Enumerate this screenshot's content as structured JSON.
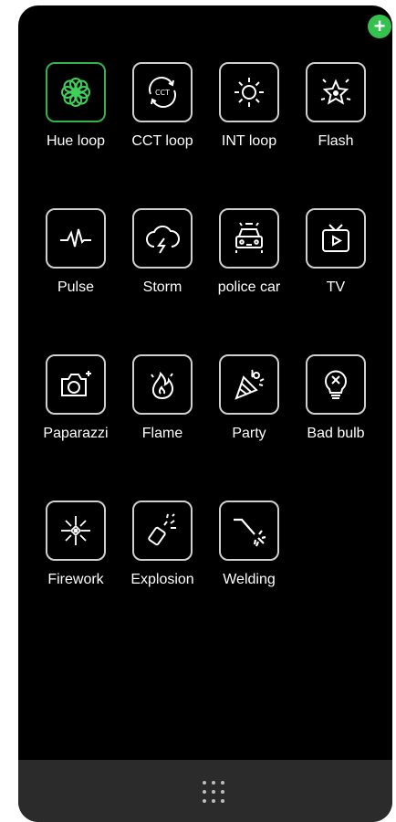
{
  "panel": {
    "add_button_label": "+",
    "effects": [
      {
        "label": "Hue loop",
        "icon": "flower-icon",
        "active": true
      },
      {
        "label": "CCT loop",
        "icon": "cct-cycle-icon",
        "active": false
      },
      {
        "label": "INT loop",
        "icon": "sun-icon",
        "active": false
      },
      {
        "label": "Flash",
        "icon": "sparkle-star-icon",
        "active": false
      },
      {
        "label": "Pulse",
        "icon": "heartbeat-icon",
        "active": false
      },
      {
        "label": "Storm",
        "icon": "storm-cloud-icon",
        "active": false
      },
      {
        "label": "police car",
        "icon": "police-car-icon",
        "active": false
      },
      {
        "label": "TV",
        "icon": "tv-icon",
        "active": false
      },
      {
        "label": "Paparazzi",
        "icon": "camera-icon",
        "active": false
      },
      {
        "label": "Flame",
        "icon": "flame-icon",
        "active": false
      },
      {
        "label": "Party",
        "icon": "party-popper-icon",
        "active": false
      },
      {
        "label": "Bad bulb",
        "icon": "broken-bulb-icon",
        "active": false
      },
      {
        "label": "Firework",
        "icon": "firework-icon",
        "active": false
      },
      {
        "label": "Explosion",
        "icon": "explosion-icon",
        "active": false
      },
      {
        "label": "Welding",
        "icon": "welding-icon",
        "active": false
      }
    ],
    "colors": {
      "background": "#000000",
      "active_accent": "#35b24a",
      "add_button": "#33c24d",
      "tile_border": "#cfcfcf",
      "bottom_bar": "#2b2b2b"
    },
    "bottom_bar": {
      "icon": "grid-dots-icon"
    }
  }
}
